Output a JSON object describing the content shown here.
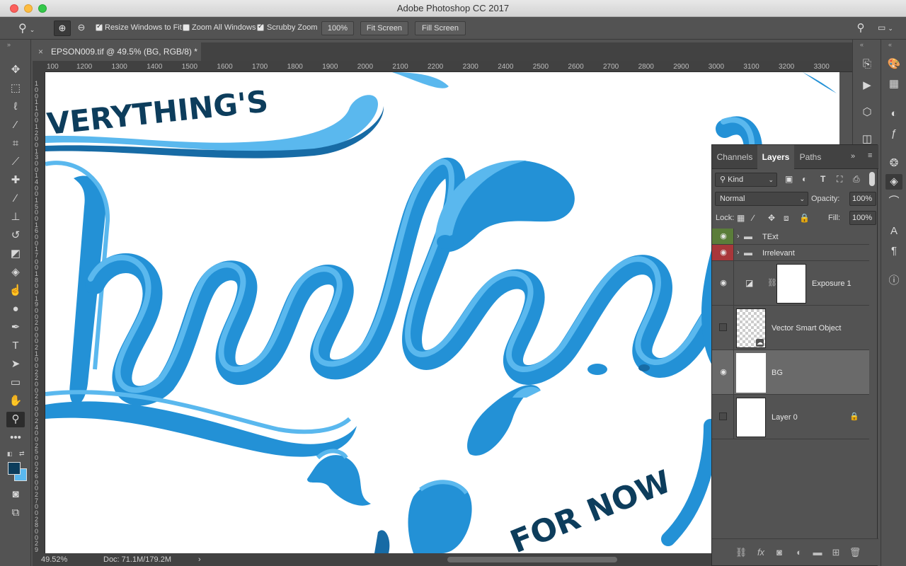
{
  "app": {
    "title": "Adobe Photoshop CC 2017"
  },
  "options": {
    "resize_windows_label": "Resize Windows to Fit",
    "zoom_all_label": "Zoom All Windows",
    "scrubby_label": "Scrubby Zoom",
    "zoom_value": "100%",
    "fit_screen": "Fit Screen",
    "fill_screen": "Fill Screen",
    "resize_checked": true,
    "zoom_all_checked": false,
    "scrubby_checked": true
  },
  "document": {
    "tab_title": "EPSON009.tif @ 49.5% (BG, RGB/8) *",
    "close": "×"
  },
  "ruler": {
    "h_labels": [
      "100",
      "1200",
      "1300",
      "1400",
      "1500",
      "1600",
      "1700",
      "1800",
      "1900",
      "2000",
      "2100",
      "2200",
      "2300",
      "2400",
      "2500",
      "2600",
      "2700",
      "2800",
      "2900",
      "3000",
      "3100",
      "3200",
      "3300"
    ],
    "v_labels": [
      "1",
      "0",
      "0",
      "1",
      "1",
      "0",
      "0",
      "1",
      "2",
      "0",
      "0",
      "1",
      "3",
      "0",
      "0",
      "1",
      "4",
      "0",
      "0",
      "1",
      "5",
      "0",
      "0",
      "1",
      "6",
      "0",
      "0",
      "1",
      "7",
      "0",
      "0",
      "1",
      "8",
      "0",
      "0",
      "1",
      "9",
      "0",
      "0",
      "2",
      "0",
      "0",
      "0",
      "2",
      "1",
      "0",
      "0",
      "2",
      "2",
      "0",
      "0",
      "2",
      "3",
      "0",
      "0",
      "2",
      "4",
      "0",
      "0",
      "2",
      "5",
      "0",
      "0",
      "2",
      "6",
      "0",
      "0",
      "2",
      "7",
      "0",
      "0",
      "2",
      "8",
      "0",
      "0",
      "2",
      "9",
      "0",
      "0"
    ]
  },
  "artwork": {
    "text_top": "VERYTHING'S",
    "text_main": "Irrelevant",
    "text_bottom": "FOR NOW",
    "colors": {
      "light": "#5ab8ee",
      "mid": "#2391d6",
      "dark": "#176ba5",
      "ink": "#0d3d5c"
    }
  },
  "status": {
    "zoom": "49.52%",
    "doc": "Doc: 71.1M/179.2M",
    "arrow": "›"
  },
  "layers_panel": {
    "tabs": [
      "Channels",
      "Layers",
      "Paths"
    ],
    "active_tab": "Layers",
    "filter_kind": "Kind",
    "blend_mode": "Normal",
    "opacity_label": "Opacity:",
    "opacity_value": "100%",
    "lock_label": "Lock:",
    "fill_label": "Fill:",
    "fill_value": "100%",
    "layers": [
      {
        "name": "TExt",
        "type": "group",
        "visible": true,
        "eye_color": "#5b7d3a"
      },
      {
        "name": "Irrelevant",
        "type": "group",
        "visible": true,
        "eye_color": "#a8373a"
      },
      {
        "name": "Exposure 1",
        "type": "adjustment",
        "visible": true
      },
      {
        "name": "Vector Smart Object",
        "type": "smart",
        "visible": false
      },
      {
        "name": "BG",
        "type": "pixel",
        "visible": true,
        "selected": true
      },
      {
        "name": "Layer 0",
        "type": "pixel",
        "visible": false,
        "locked": true
      }
    ]
  }
}
